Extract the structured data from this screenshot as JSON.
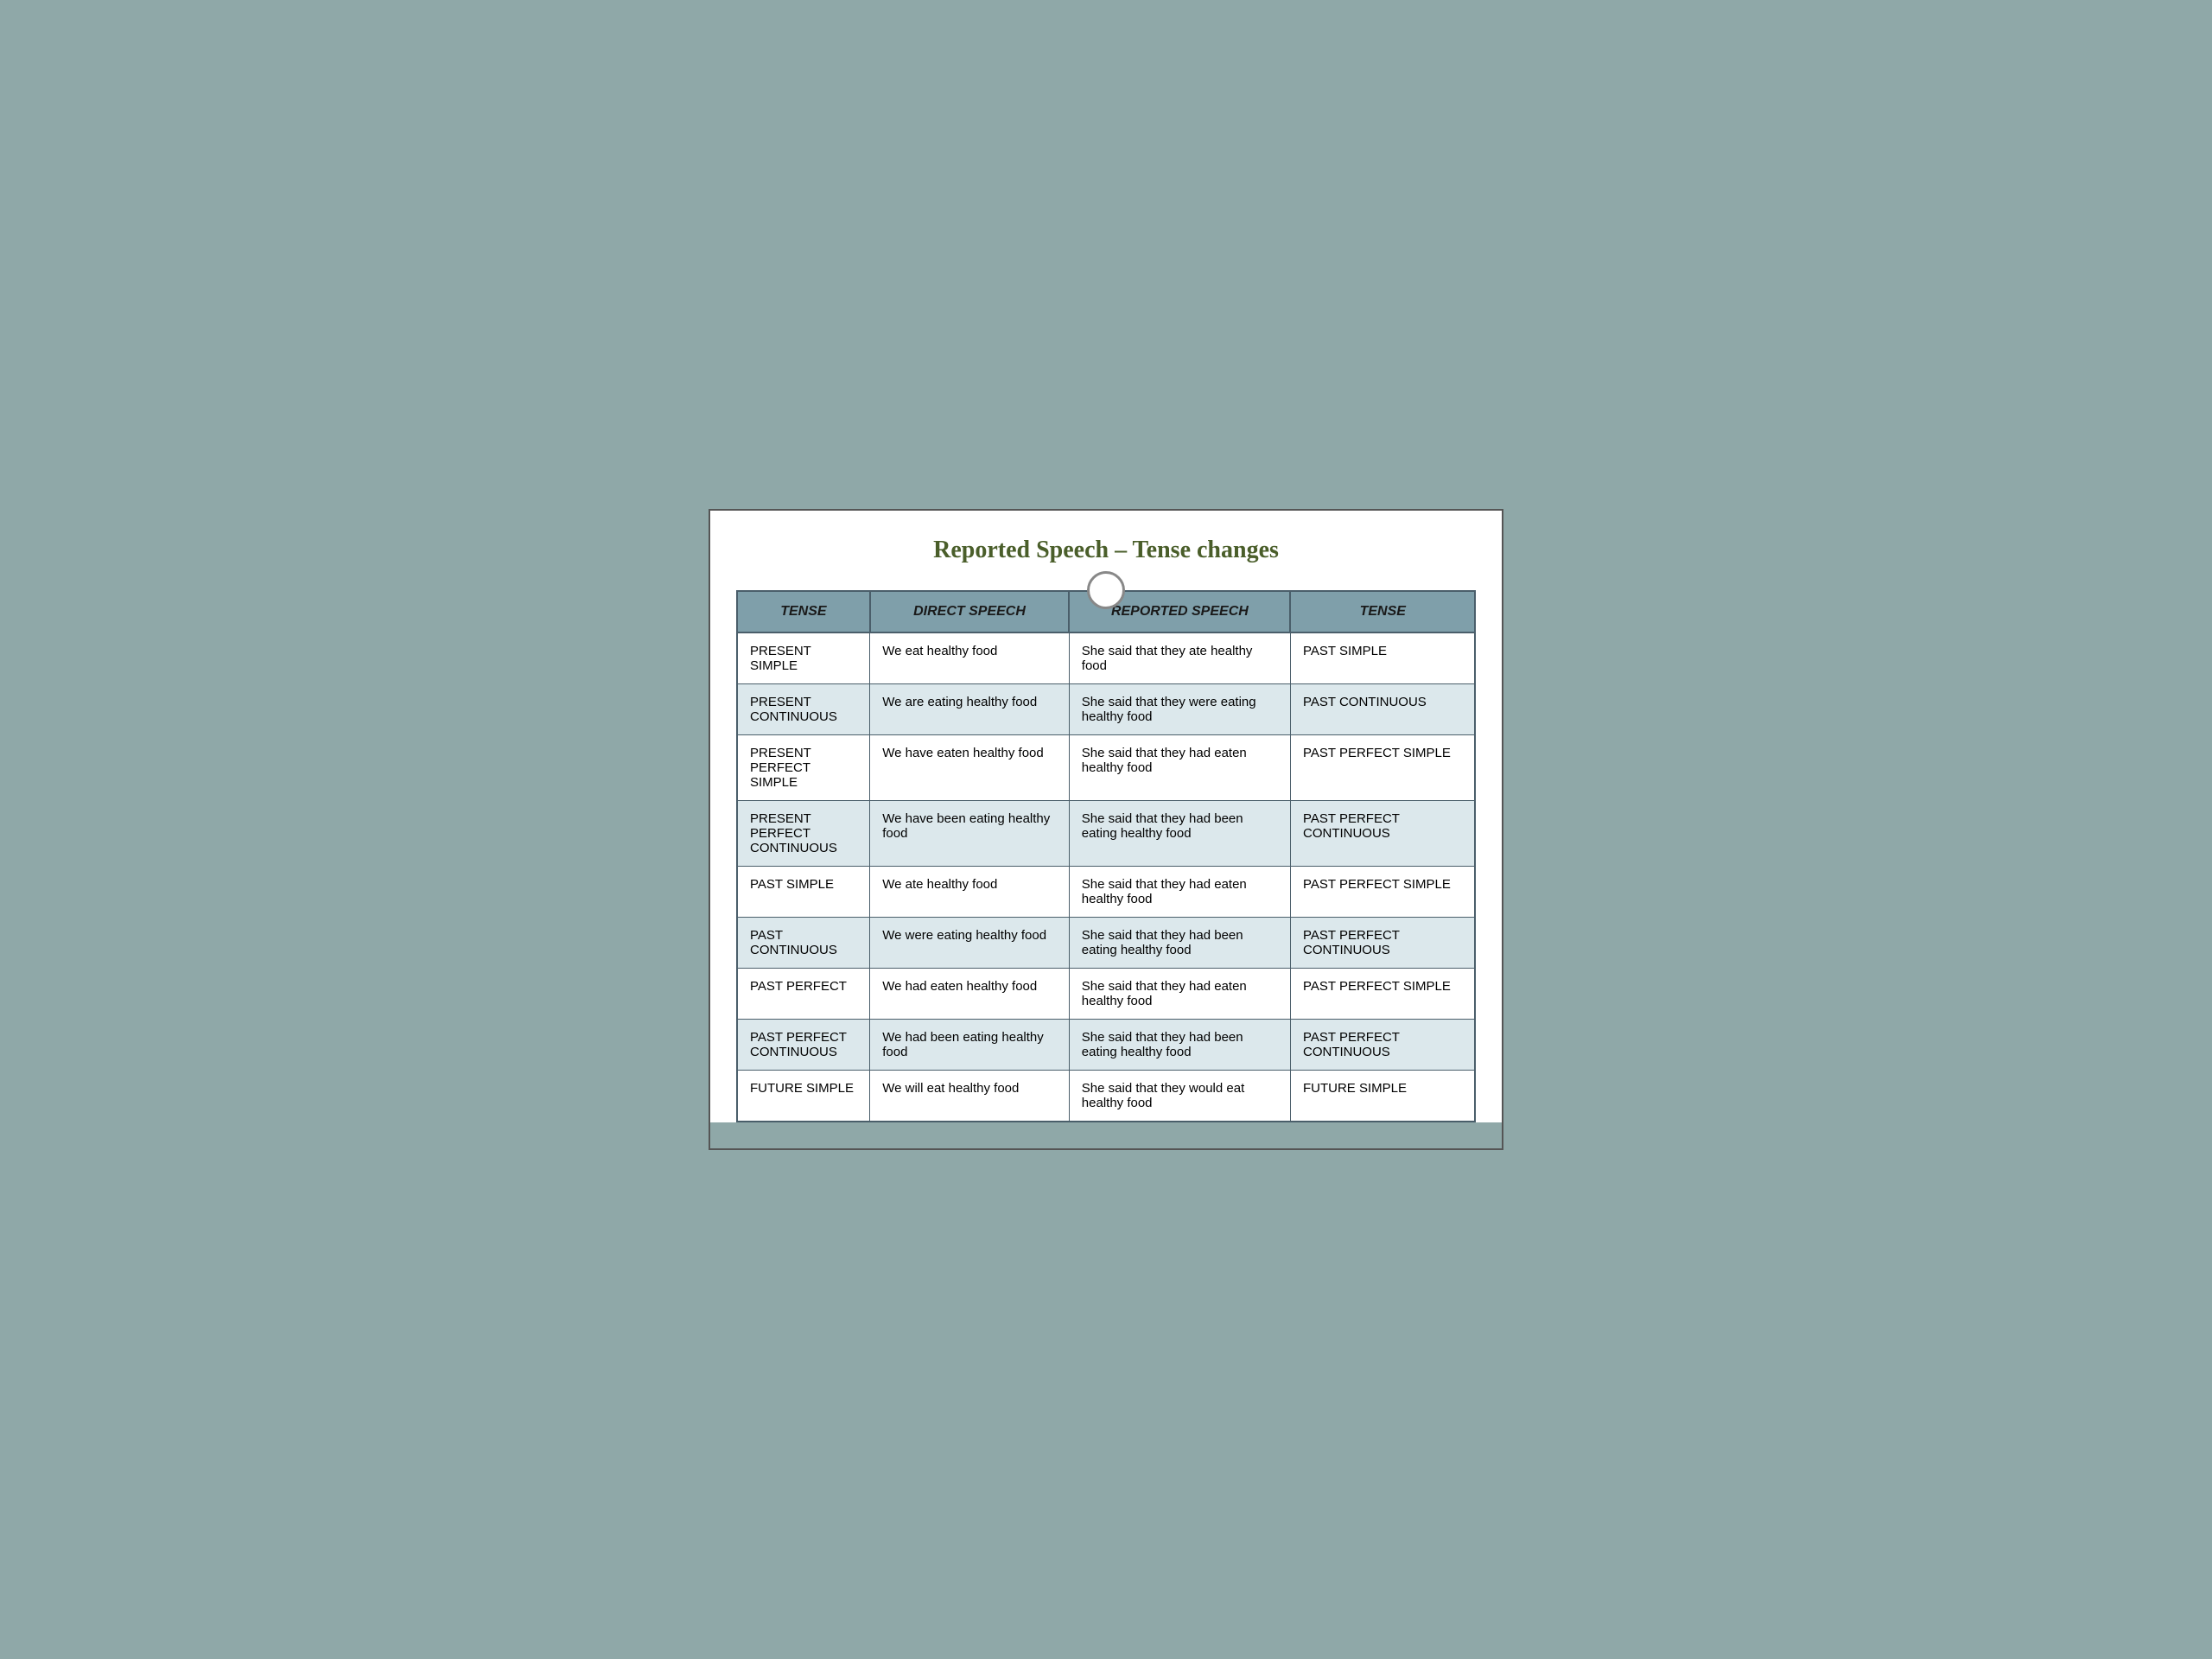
{
  "title": "Reported Speech – Tense changes",
  "headers": {
    "tense": "TENSE",
    "direct": "DIRECT SPEECH",
    "reported": "REPORTED SPEECH",
    "tense2": "TENSE"
  },
  "rows": [
    {
      "tense": "PRESENT SIMPLE",
      "direct": "We eat healthy food",
      "reported": "She said that they ate healthy food",
      "tense2": "PAST SIMPLE"
    },
    {
      "tense": "PRESENT CONTINUOUS",
      "direct": "We are eating healthy food",
      "reported": "She said that they were eating healthy food",
      "tense2": "PAST CONTINUOUS"
    },
    {
      "tense": "PRESENT PERFECT SIMPLE",
      "direct": "We have eaten healthy food",
      "reported": "She said that they had eaten healthy food",
      "tense2": "PAST PERFECT SIMPLE"
    },
    {
      "tense": "PRESENT PERFECT CONTINUOUS",
      "direct": "We have been eating healthy food",
      "reported": "She said that they had been eating  healthy food",
      "tense2": "PAST PERFECT CONTINUOUS"
    },
    {
      "tense": "PAST SIMPLE",
      "direct": "We ate healthy food",
      "reported": "She said that they had eaten healthy food",
      "tense2": "PAST PERFECT SIMPLE"
    },
    {
      "tense": "PAST CONTINUOUS",
      "direct": "We were eating healthy food",
      "reported": "She said that they had been eating healthy food",
      "tense2": "PAST PERFECT CONTINUOUS"
    },
    {
      "tense": "PAST PERFECT",
      "direct": "We had eaten healthy food",
      "reported": "She said that they had eaten healthy food",
      "tense2": "PAST PERFECT SIMPLE"
    },
    {
      "tense": "PAST PERFECT CONTINUOUS",
      "direct": "We had been eating healthy food",
      "reported": "She said that they had been eating  healthy food",
      "tense2": "PAST PERFECT CONTINUOUS"
    },
    {
      "tense": "FUTURE SIMPLE",
      "direct": "We will eat healthy food",
      "reported": "She said that they would eat healthy food",
      "tense2": "FUTURE SIMPLE"
    }
  ]
}
